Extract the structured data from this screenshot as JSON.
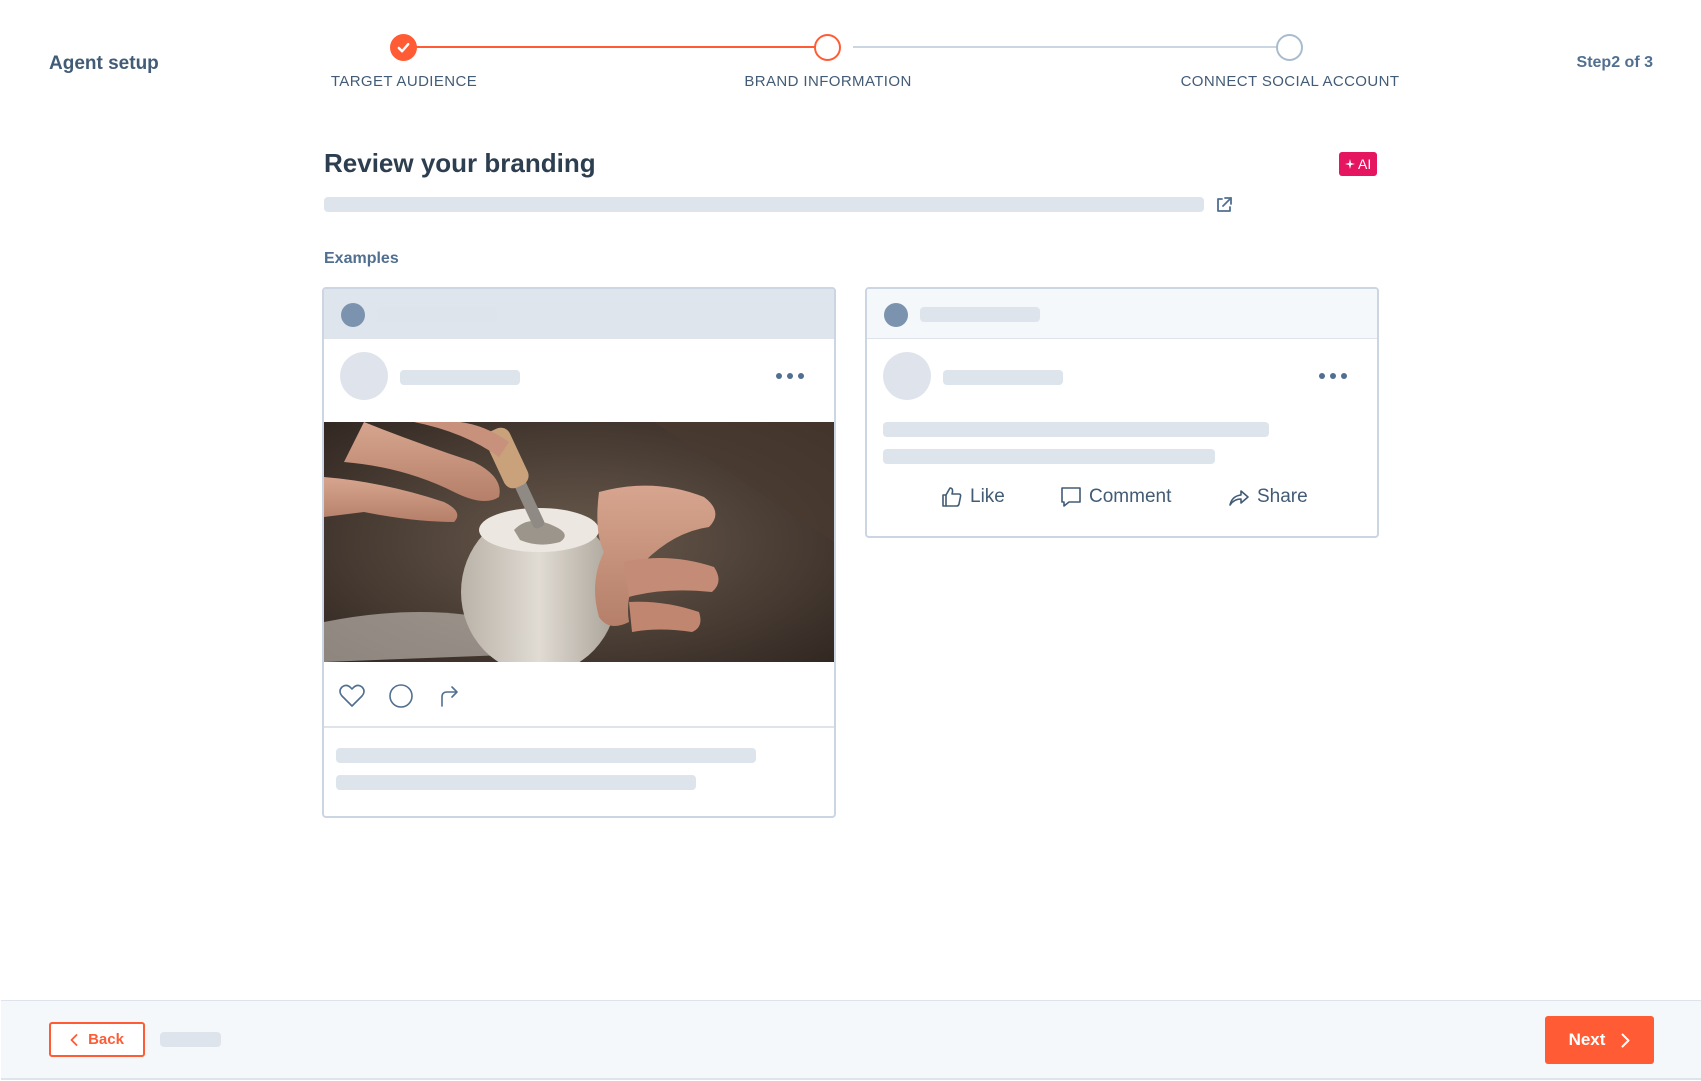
{
  "header": {
    "title": "Agent setup",
    "step_count": "Step2 of 3"
  },
  "stepper": {
    "steps": [
      {
        "label": "TARGET AUDIENCE",
        "state": "complete"
      },
      {
        "label": "BRAND INFORMATION",
        "state": "active"
      },
      {
        "label": "CONNECT SOCIAL ACCOUNT",
        "state": "pending"
      }
    ]
  },
  "main": {
    "title": "Review your branding",
    "ai_badge": "AI",
    "examples_label": "Examples"
  },
  "social_preview": {
    "actions": {
      "like": "Like",
      "comment": "Comment",
      "share": "Share"
    }
  },
  "footer": {
    "back_label": "Back",
    "next_label": "Next"
  },
  "colors": {
    "accent": "#ff5c35",
    "ai_badge": "#e5165f",
    "skeleton": "#dde4ec",
    "text_primary": "#2d3e50",
    "text_secondary": "#516f90"
  }
}
